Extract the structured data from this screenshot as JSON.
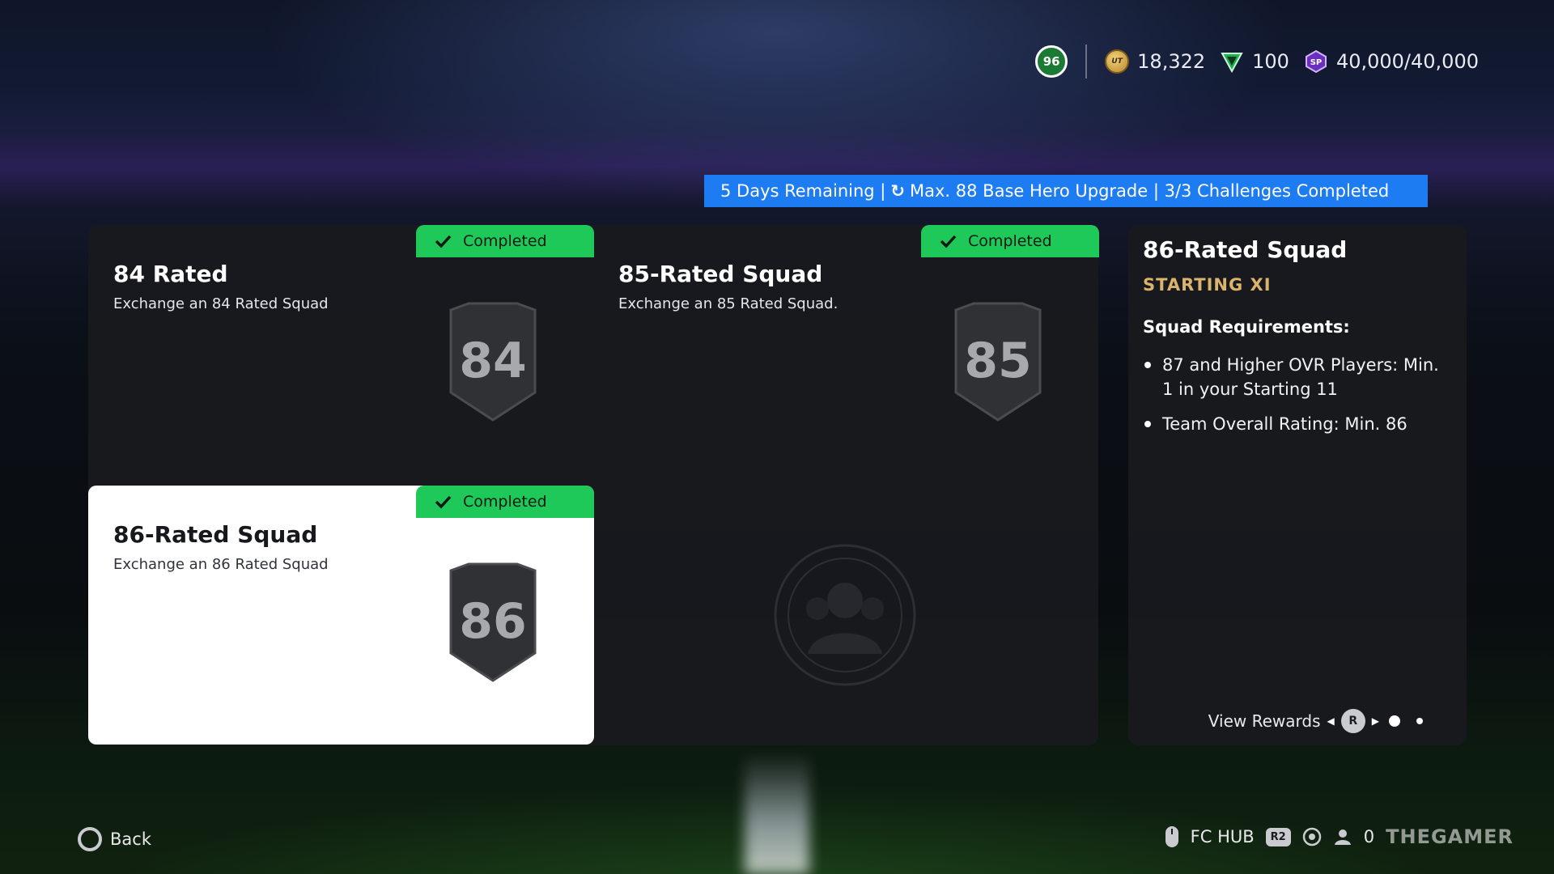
{
  "header": {
    "club_badge_icon": "club-crest-icon",
    "currencies": [
      {
        "icon": "coins-icon",
        "coin_text": "UT",
        "value": "18,322"
      },
      {
        "icon": "fc-points-icon",
        "value": "100"
      },
      {
        "icon": "season-points-icon",
        "icon_text": "SP",
        "value": "40,000/40,000"
      }
    ]
  },
  "banner": {
    "days": "5 Days Remaining |",
    "refresh_icon": "refresh-icon",
    "refresh_glyph": "↻",
    "upgrade": "Max. 88 Base Hero Upgrade | 3/3 Challenges Completed",
    "color": "#1e7cf2"
  },
  "challenges": [
    {
      "title": "84 Rated",
      "desc": "Exchange an 84 Rated Squad",
      "status": "Completed",
      "rating": "84"
    },
    {
      "title": "85-Rated Squad",
      "desc": "Exchange an 85 Rated Squad.",
      "status": "Completed",
      "rating": "85"
    },
    {
      "title": "86-Rated Squad",
      "desc": "Exchange an 86 Rated Squad",
      "status": "Completed",
      "rating": "86"
    }
  ],
  "detail": {
    "title": "86-Rated Squad",
    "subtitle": "STARTING XI",
    "requirements_heading": "Squad Requirements:",
    "requirements": [
      "87 and Higher OVR Players: Min. 1 in your Starting 11",
      "Team Overall Rating: Min. 86"
    ],
    "view_rewards": "View Rewards",
    "r_button": "R"
  },
  "footer": {
    "back": "Back",
    "fc_hub": "FC HUB",
    "r2": "R2",
    "friends_count": "0",
    "watermark": "THEGAMER"
  },
  "colors": {
    "completed_green": "#1ec95a",
    "accent_gold": "#d9b46a",
    "panel_bg": "#191a1e"
  }
}
